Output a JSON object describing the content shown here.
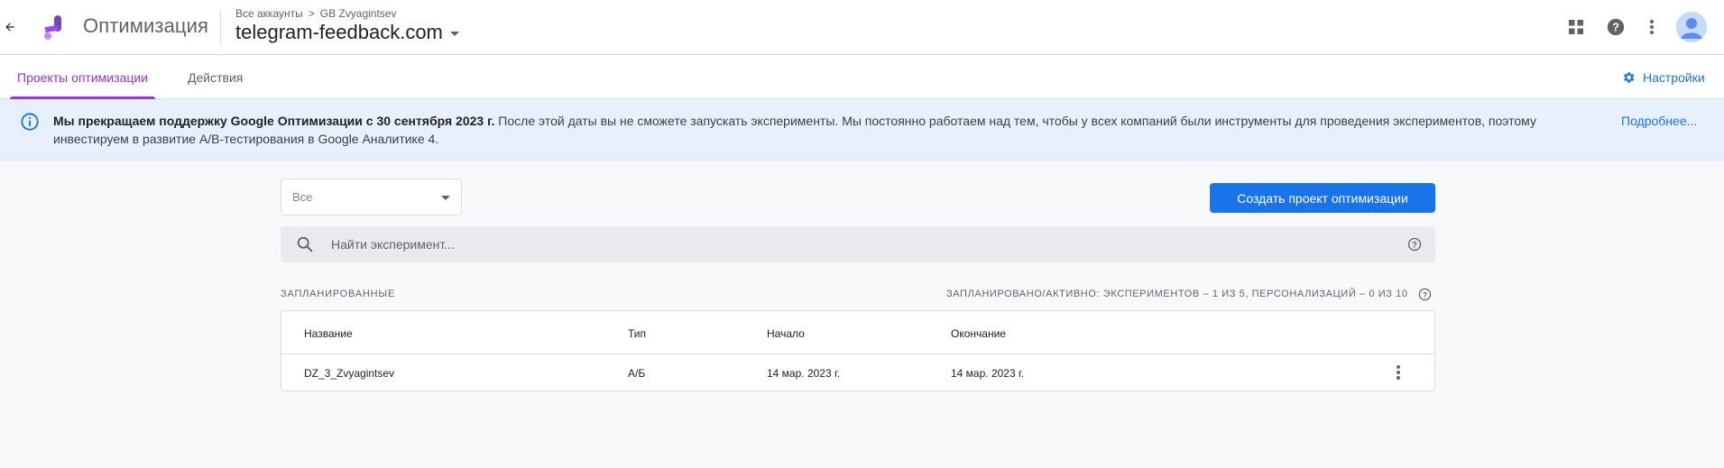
{
  "header": {
    "app_title": "Оптимизация",
    "breadcrumb": {
      "accounts": "Все аккаунты",
      "separator": ">",
      "account": "GB Zvyagintsev"
    },
    "container": "telegram-feedback.com",
    "icons": [
      "back-arrow-icon",
      "apps-grid-icon",
      "help-icon",
      "more-vert-icon",
      "avatar"
    ]
  },
  "tabs": [
    {
      "label": "Проекты оптимизации",
      "active": true
    },
    {
      "label": "Действия",
      "active": false
    }
  ],
  "settings_label": "Настройки",
  "banner": {
    "bold": "Мы прекращаем поддержку Google Оптимизации с 30 сентября 2023 г.",
    "text": " После этой даты вы не сможете запускать эксперименты. Мы постоянно работаем над тем, чтобы у всех компаний были инструменты для проведения экспериментов, поэтому инвестируем в развитие A/B-тестирования в Google Аналитике 4.",
    "more": "Подробнее..."
  },
  "filter": {
    "selected": "Все"
  },
  "create_button": "Создать проект оптимизации",
  "search": {
    "placeholder": "Найти эксперимент..."
  },
  "section": {
    "title": "ЗАПЛАНИРОВАННЫЕ",
    "quota": "ЗАПЛАНИРОВАНО/АКТИВНО: ЭКСПЕРИМЕНТОВ – 1 ИЗ 5, ПЕРСОНАЛИЗАЦИЙ – 0 ИЗ 10"
  },
  "table": {
    "columns": [
      "Название",
      "Тип",
      "Начало",
      "Окончание"
    ],
    "rows": [
      {
        "name": "DZ_3_Zvyagintsev",
        "type": "A/Б",
        "start": "14 мар. 2023 г.",
        "end": "14 мар. 2023 г."
      }
    ]
  },
  "colors": {
    "accent": "#9334e6",
    "primary": "#1a73e8",
    "banner_bg": "#e8f0fe",
    "page_bg": "#f8f9fa"
  }
}
